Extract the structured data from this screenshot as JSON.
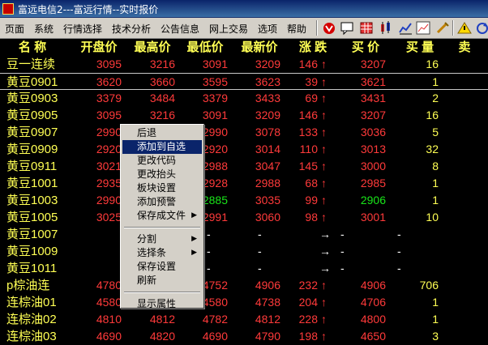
{
  "window": {
    "title": "富远电信2---富远行情--实时报价"
  },
  "menu": [
    "页面",
    "系统",
    "行情选择",
    "技术分析",
    "公告信息",
    "网上交易",
    "选项",
    "帮助"
  ],
  "toolbar": [
    "stop-icon",
    "chat-icon",
    "grid-icon",
    "candlestick-icon",
    "kline-icon",
    "trend-icon",
    "tool-icon",
    "warning-icon",
    "refresh-icon"
  ],
  "colors": {
    "up": "#ff3a3a",
    "down": "#19e619",
    "flat": "#ffffff",
    "name": "#ffff54",
    "background": "#000000"
  },
  "table": {
    "headers": [
      "名  称",
      "开盘价",
      "最高价",
      "最低价",
      "最新价",
      "涨  跌",
      "买  价",
      "买  量",
      "卖"
    ],
    "rows": [
      {
        "name": "豆一连续",
        "open": "3095",
        "high": "3216",
        "low": "3091",
        "last": "3209",
        "change": "146",
        "bid": "3207",
        "bidvol": "16",
        "ask": "320",
        "dir": "up"
      },
      {
        "name": "黄豆0901",
        "open": "3620",
        "high": "3660",
        "low": "3595",
        "last": "3623",
        "change": "39",
        "bid": "3621",
        "bidvol": "1",
        "ask": "362",
        "dir": "up"
      },
      {
        "name": "黄豆0903",
        "open": "3379",
        "high": "3484",
        "low": "3379",
        "last": "3433",
        "change": "69",
        "bid": "3431",
        "bidvol": "2",
        "ask": "3447",
        "dir": "up"
      },
      {
        "name": "黄豆0905",
        "open": "3095",
        "high": "3216",
        "low": "3091",
        "last": "3209",
        "change": "146",
        "bid": "3207",
        "bidvol": "16",
        "ask": "320",
        "dir": "up"
      },
      {
        "name": "黄豆0907",
        "open": "2990",
        "high": "",
        "low": "2990",
        "last": "3078",
        "change": "133",
        "bid": "3036",
        "bidvol": "5",
        "ask": "3078",
        "dir": "up"
      },
      {
        "name": "黄豆0909",
        "open": "2920",
        "high": "",
        "low": "2920",
        "last": "3014",
        "change": "110",
        "bid": "3013",
        "bidvol": "32",
        "ask": "3015",
        "dir": "up"
      },
      {
        "name": "黄豆0911",
        "open": "3021",
        "high": "",
        "low": "2988",
        "last": "3047",
        "change": "145",
        "bid": "3000",
        "bidvol": "8",
        "ask": "3047",
        "dir": "up"
      },
      {
        "name": "黄豆1001",
        "open": "2935",
        "high": "",
        "low": "2928",
        "last": "2988",
        "change": "68",
        "bid": "2985",
        "bidvol": "1",
        "ask": "2987",
        "dir": "up"
      },
      {
        "name": "黄豆1003",
        "open": "2990",
        "high": "",
        "low": "2885",
        "last": "3035",
        "change": "99",
        "bid": "2906",
        "bidvol": "1",
        "ask": "3055",
        "dir": "up",
        "lowdown": true,
        "biddown": true
      },
      {
        "name": "黄豆1005",
        "open": "3025",
        "high": "",
        "low": "2991",
        "last": "3060",
        "change": "98",
        "bid": "3001",
        "bidvol": "10",
        "ask": "3099",
        "dir": "up"
      },
      {
        "name": "黄豆1007",
        "open": "",
        "high": "",
        "low": "",
        "last": "",
        "change": "",
        "bid": "",
        "bidvol": "",
        "ask": "",
        "dir": "none"
      },
      {
        "name": "黄豆1009",
        "open": "",
        "high": "",
        "low": "",
        "last": "",
        "change": "",
        "bid": "",
        "bidvol": "",
        "ask": "",
        "dir": "none"
      },
      {
        "name": "黄豆1011",
        "open": "",
        "high": "",
        "low": "",
        "last": "",
        "change": "",
        "bid": "",
        "bidvol": "",
        "ask": "",
        "dir": "none"
      },
      {
        "name": "p棕油连",
        "open": "4780",
        "high": "",
        "low": "4752",
        "last": "4906",
        "change": "232",
        "bid": "4906",
        "bidvol": "706",
        "ask": "",
        "dir": "up"
      },
      {
        "name": "连棕油01",
        "open": "4580",
        "high": "",
        "low": "4580",
        "last": "4738",
        "change": "204",
        "bid": "4706",
        "bidvol": "1",
        "ask": "4738",
        "dir": "up"
      },
      {
        "name": "连棕油02",
        "open": "4810",
        "high": "4812",
        "low": "4782",
        "last": "4812",
        "change": "228",
        "bid": "4800",
        "bidvol": "1",
        "ask": "4812",
        "dir": "up"
      },
      {
        "name": "连棕油03",
        "open": "4690",
        "high": "4820",
        "low": "4690",
        "last": "4790",
        "change": "198",
        "bid": "4650",
        "bidvol": "3",
        "ask": "4820",
        "dir": "up"
      }
    ]
  },
  "context_menu": {
    "items": [
      {
        "label": "后退",
        "submenu": false
      },
      {
        "label": "添加到自选",
        "submenu": false,
        "highlighted": true
      },
      {
        "label": "更改代码",
        "submenu": false
      },
      {
        "label": "更改抬头",
        "submenu": false
      },
      {
        "label": "板块设置",
        "submenu": false
      },
      {
        "label": "添加预警",
        "submenu": false
      },
      {
        "label": "保存成文件",
        "submenu": true
      },
      {
        "sep": true
      },
      {
        "label": "分割",
        "submenu": true
      },
      {
        "label": "选择条",
        "submenu": true
      },
      {
        "label": "保存设置",
        "submenu": false
      },
      {
        "label": "刷新",
        "submenu": false
      },
      {
        "sep": true
      },
      {
        "label": "显示属性",
        "submenu": false
      }
    ]
  }
}
